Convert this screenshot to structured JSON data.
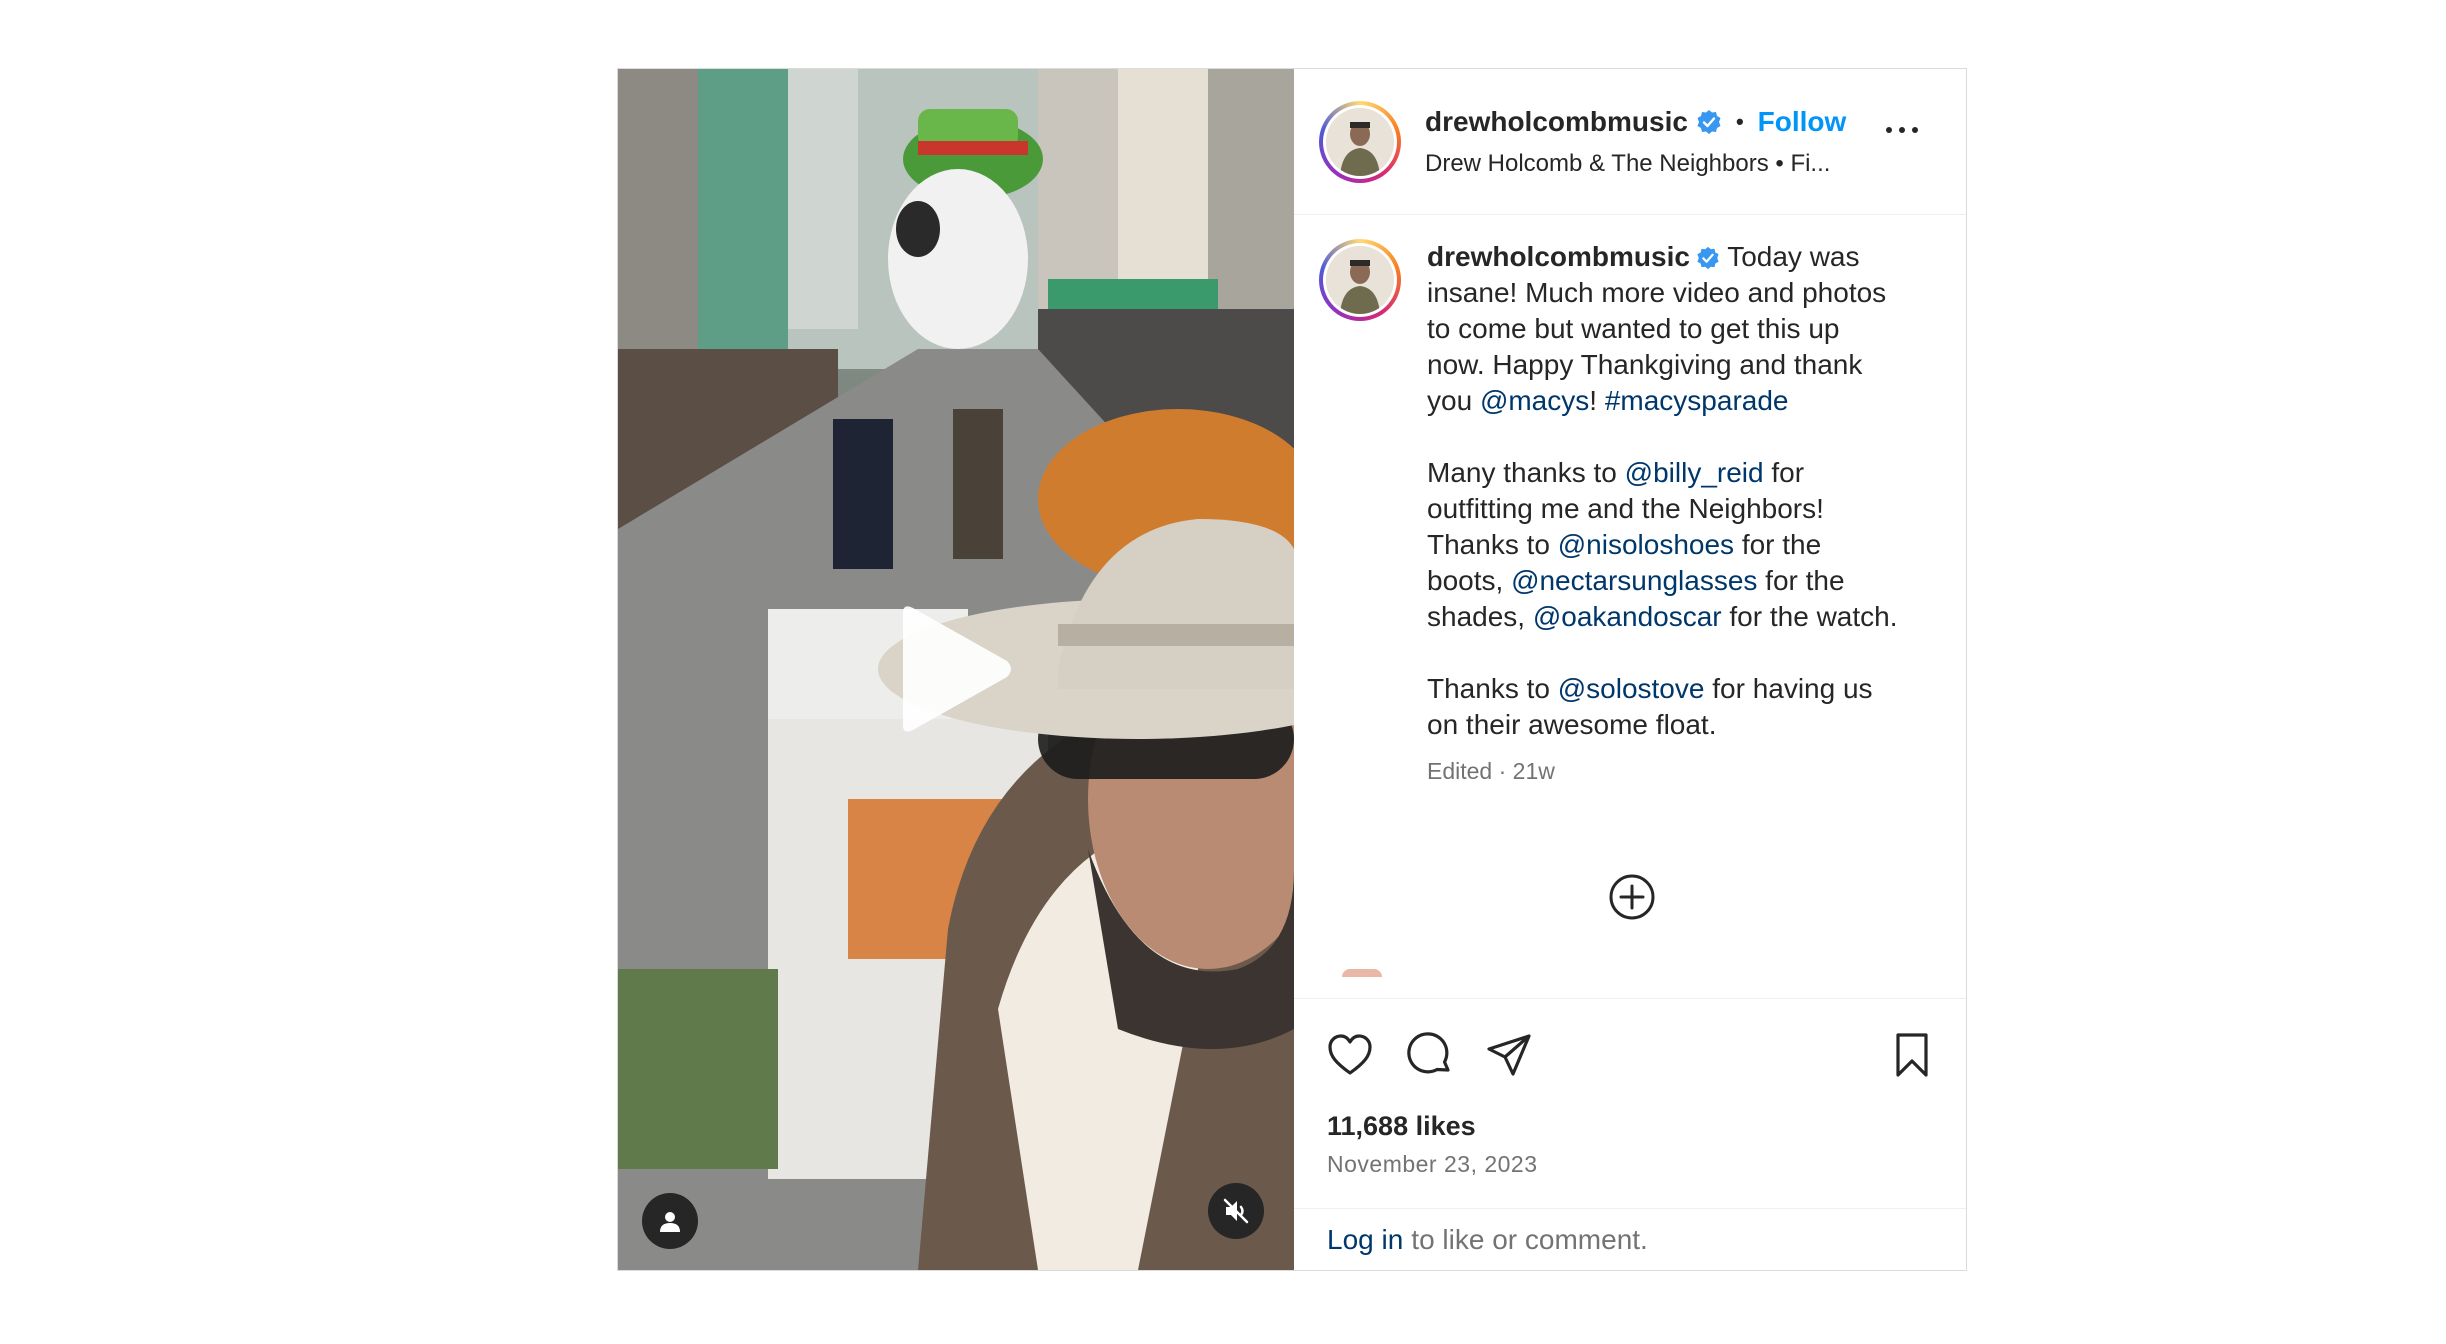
{
  "post": {
    "username": "drewholcombmusic",
    "follow_label": "Follow",
    "separator": "•",
    "subtitle": "Drew Holcomb & The Neighbors • Fi...",
    "caption": {
      "username": "drewholcombmusic",
      "p1_text": " Today was insane! Much more video and photos to come but wanted to get this up now. Happy Thankgiving and thank you ",
      "p1_mention": "@macys",
      "p1_bang": "! ",
      "p1_hashtag": "#macysparade",
      "p2_a": "Many thanks to ",
      "p2_m1": "@billy_reid",
      "p2_b": " for outfitting me and the Neighbors! Thanks to ",
      "p2_m2": "@nisoloshoes",
      "p2_c": " for the boots, ",
      "p2_m3": "@nectarsunglasses",
      "p2_d": " for the shades, ",
      "p2_m4": "@oakandoscar",
      "p2_e": " for the watch.",
      "p3_a": "Thanks to ",
      "p3_m1": "@solostove",
      "p3_b": " for having us on their awesome float.",
      "meta": "Edited · 21w"
    },
    "likes": "11,688 likes",
    "date": "November 23, 2023",
    "login_link": "Log in",
    "login_rest": "to like or comment."
  },
  "icons": {
    "verified": "verified-badge-icon",
    "more": "more-options-icon",
    "add_comment": "plus-circle-icon",
    "like": "heart-icon",
    "comment": "comment-icon",
    "share": "share-icon",
    "save": "bookmark-icon",
    "play": "play-icon",
    "tag": "user-tag-icon",
    "mute": "muted-speaker-icon"
  },
  "colors": {
    "link": "#00376b",
    "follow": "#0095f6",
    "verified": "#3897f0",
    "muted_text": "#737373"
  }
}
